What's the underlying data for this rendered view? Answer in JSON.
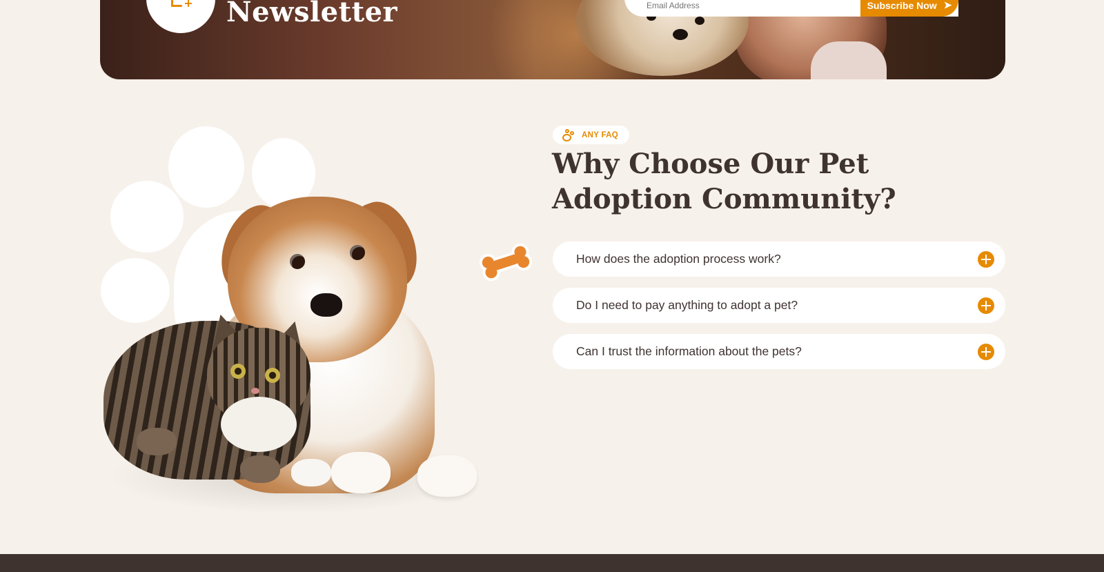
{
  "newsletter": {
    "title": "Newsletter",
    "email_placeholder": "Email Address",
    "submit_label": "Subscribe Now",
    "icon": "newsletter-icon"
  },
  "faq_section": {
    "badge": {
      "label": "ANY FAQ",
      "icon": "paw-icon"
    },
    "heading": "Why Choose Our Pet Adoption Community?",
    "items": [
      {
        "question": "How does the adoption process work?",
        "icon": "plus-icon"
      },
      {
        "question": "Do I need to pay anything to adopt a pet?",
        "icon": "plus-icon"
      },
      {
        "question": "Can I trust the information about the pets?",
        "icon": "plus-icon"
      }
    ]
  },
  "colors": {
    "accent": "#e68a00",
    "background": "#f6f1ea",
    "text_dark": "#3f3330",
    "bone": "#e8862e"
  }
}
